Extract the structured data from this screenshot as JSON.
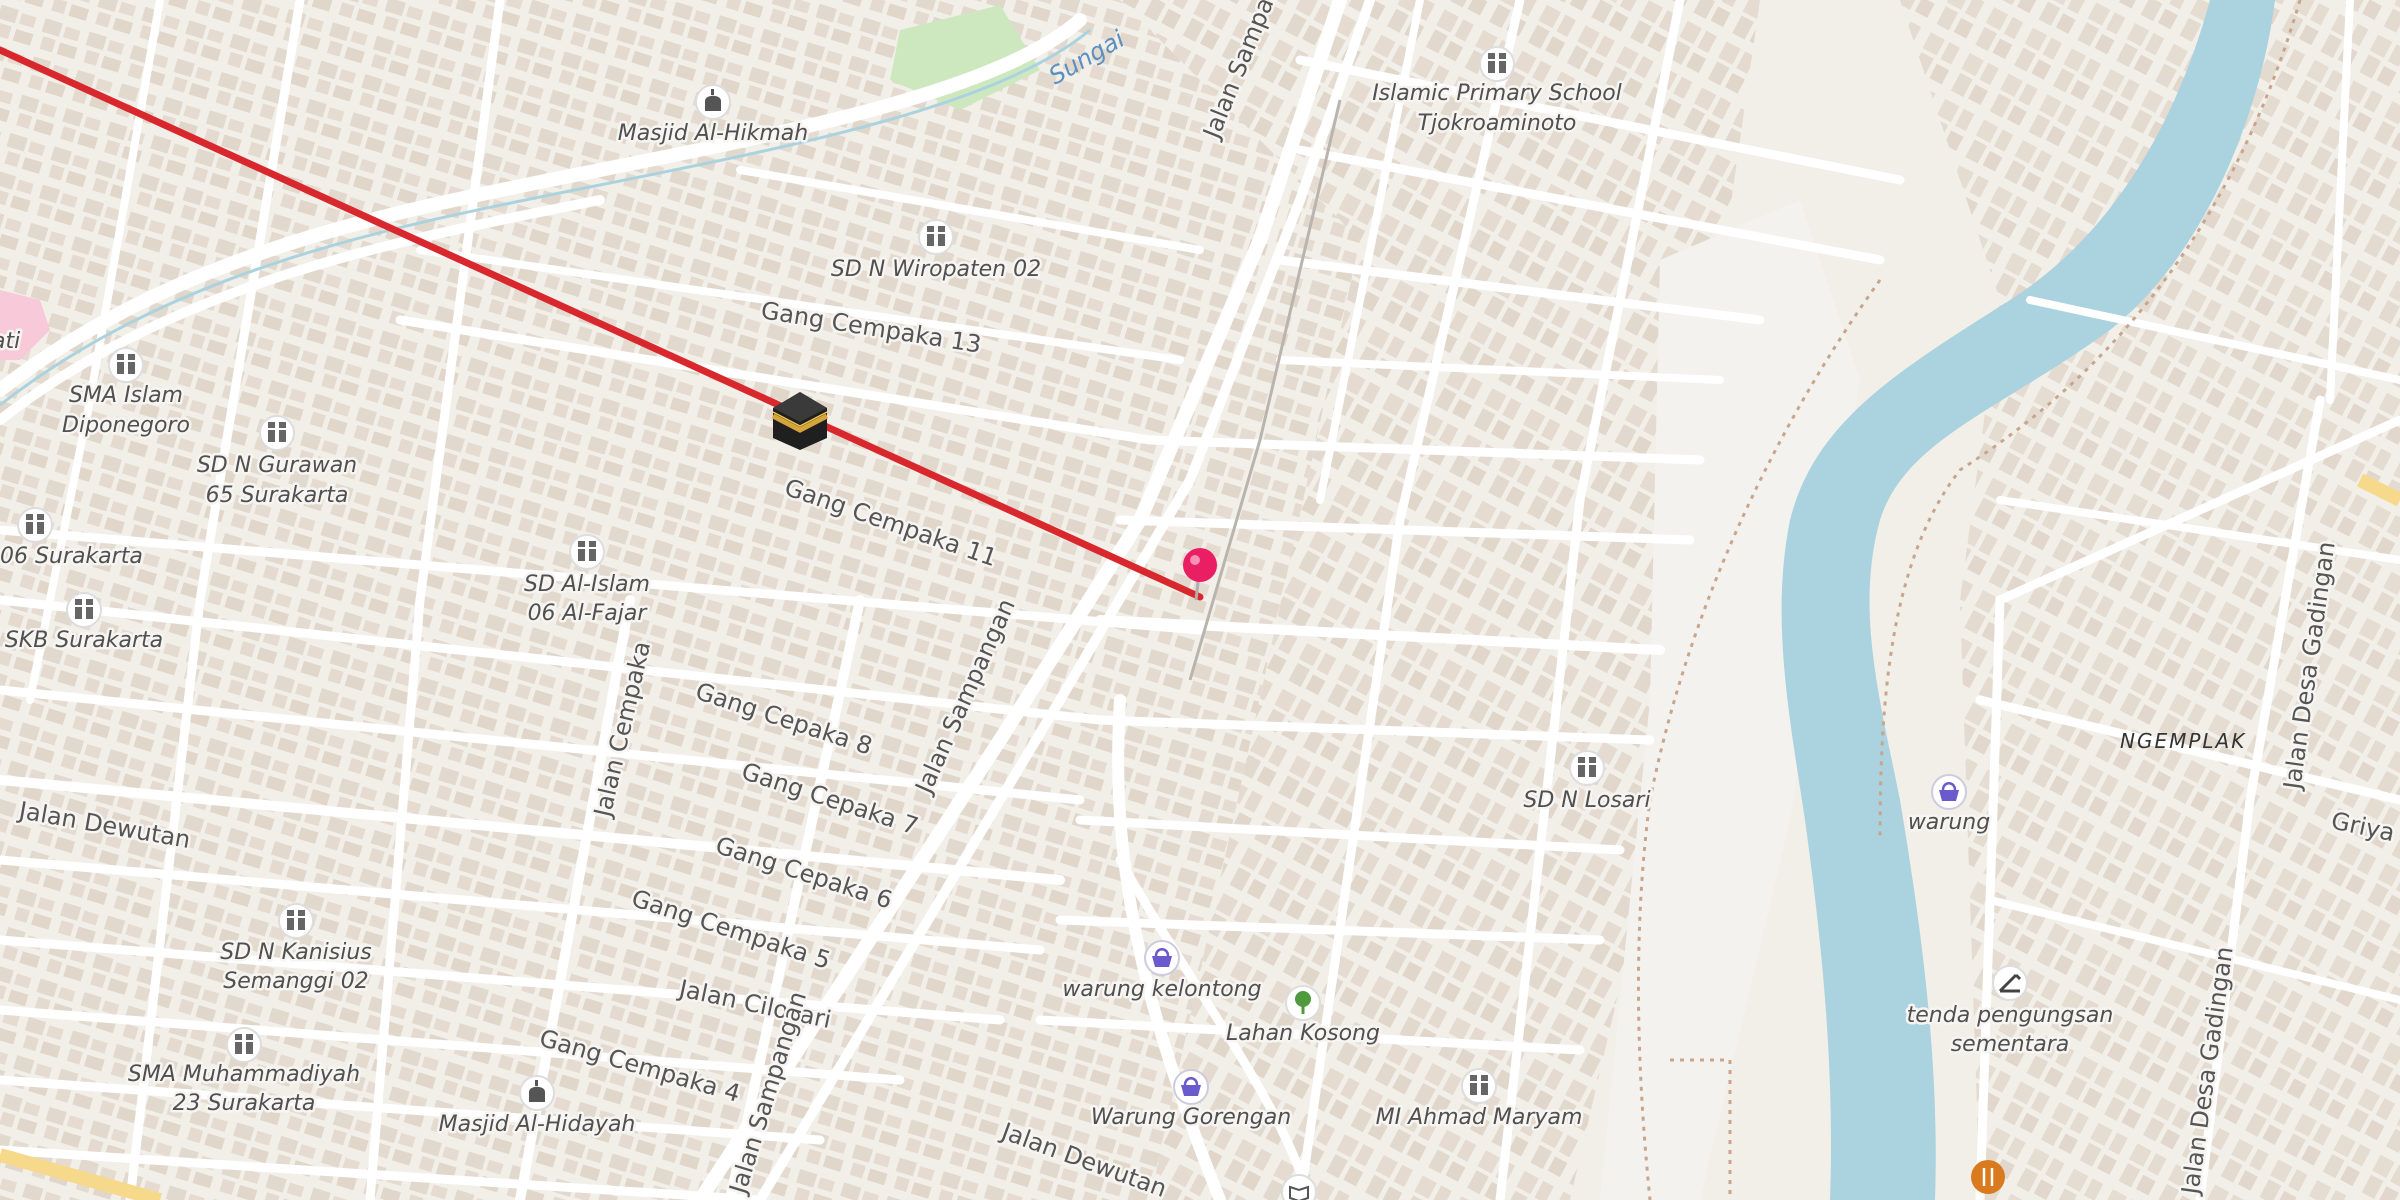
{
  "map": {
    "river_label": "Sungai",
    "place_label": "NGEMPLAK",
    "partial_label_left": "ati",
    "pois": [
      {
        "kind": "school",
        "icon": "school-icon",
        "lines": [
          "Islamic Primary School",
          "Tjokroaminoto"
        ]
      },
      {
        "kind": "mosque",
        "icon": "mosque-icon",
        "lines": [
          "Masjid Al-Hikmah"
        ]
      },
      {
        "kind": "school",
        "icon": "school-icon",
        "lines": [
          "SD N Wiropaten 02"
        ]
      },
      {
        "kind": "school",
        "icon": "school-icon",
        "lines": [
          "SMA Islam",
          "Diponegoro"
        ]
      },
      {
        "kind": "school",
        "icon": "school-icon",
        "lines": [
          "SD N Gurawan",
          "65 Surakarta"
        ]
      },
      {
        "kind": "school",
        "icon": "school-icon",
        "lines": [
          "06 Surakarta"
        ]
      },
      {
        "kind": "school",
        "icon": "school-icon",
        "lines": [
          "SD Al-Islam",
          "06 Al-Fajar"
        ]
      },
      {
        "kind": "school",
        "icon": "school-icon",
        "lines": [
          "SKB Surakarta"
        ]
      },
      {
        "kind": "school",
        "icon": "school-icon",
        "lines": [
          "SD N Losari"
        ]
      },
      {
        "kind": "shop",
        "icon": "basket-icon",
        "lines": [
          "warung"
        ]
      },
      {
        "kind": "school",
        "icon": "school-icon",
        "lines": [
          "SD N Kanisius",
          "Semanggi 02"
        ]
      },
      {
        "kind": "school",
        "icon": "school-icon",
        "lines": [
          "SMA Muhammadiyah",
          "23 Surakarta"
        ]
      },
      {
        "kind": "mosque",
        "icon": "mosque-icon",
        "lines": [
          "Masjid Al-Hidayah"
        ]
      },
      {
        "kind": "shop",
        "icon": "basket-icon",
        "lines": [
          "warung kelontong"
        ]
      },
      {
        "kind": "park",
        "icon": "tree-icon",
        "lines": [
          "Lahan Kosong"
        ]
      },
      {
        "kind": "shop",
        "icon": "basket-icon",
        "lines": [
          "Warung Gorengan"
        ]
      },
      {
        "kind": "school",
        "icon": "school-icon",
        "lines": [
          "MI Ahmad Maryam"
        ]
      },
      {
        "kind": "shelter",
        "icon": "shelter-icon",
        "lines": [
          "tenda pengungsan",
          "sementara"
        ]
      }
    ],
    "streets": [
      "Gang Cempaka 13",
      "Gang Cempaka 11",
      "Gang Cepaka 8",
      "Gang Cepaka 7",
      "Gang Cepaka 6",
      "Gang Cempaka 5",
      "Jalan Cilosari",
      "Gang Cempaka 4",
      "Jalan Dewutan",
      "Jalan Dewutan",
      "Jalan Cempaka",
      "Jalan Sampangan",
      "Jalan Sampangan",
      "Jalan Sampangan",
      "Jalan Desa Gadingan",
      "Jalan Desa Gadingan",
      "Griya"
    ],
    "colors": {
      "background": "#f2efe9",
      "building": "#e2d8cd",
      "road": "#ffffff",
      "river": "#aad3df",
      "qibla_line": "#d9272e",
      "pin": "#e91e63",
      "major_road": "#f7d98b"
    },
    "markers": {
      "kaaba_icon": "kaaba-icon",
      "pin_icon": "location-pin-icon"
    }
  }
}
